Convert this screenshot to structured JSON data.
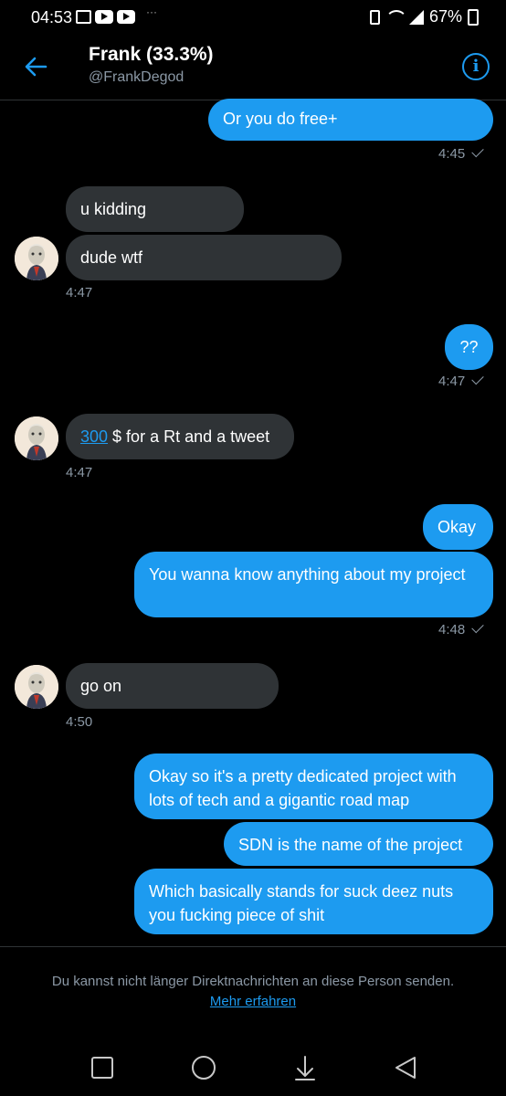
{
  "status_bar": {
    "time": "04:53",
    "dots": "···",
    "battery": "67%"
  },
  "header": {
    "name": "Frank (33.3%)",
    "handle": "@FrankDegod",
    "info_glyph": "i"
  },
  "messages": [
    {
      "id": "m1",
      "dir": "sent",
      "text": "Or you do free+"
    },
    {
      "id": "t1",
      "text": "4:45"
    },
    {
      "id": "m2",
      "dir": "recv",
      "text": "u kidding"
    },
    {
      "id": "m3",
      "dir": "recv",
      "text": "dude wtf"
    },
    {
      "id": "t2",
      "text": "4:47"
    },
    {
      "id": "m4",
      "dir": "sent",
      "text": "??"
    },
    {
      "id": "t3",
      "text": "4:47"
    },
    {
      "id": "m5",
      "dir": "recv",
      "link": "300",
      "text": " $ for a Rt and a tweet"
    },
    {
      "id": "t4",
      "text": "4:47"
    },
    {
      "id": "m6",
      "dir": "sent",
      "text": "Okay"
    },
    {
      "id": "m7",
      "dir": "sent",
      "text": "You wanna know anything about my project"
    },
    {
      "id": "t5",
      "text": "4:48"
    },
    {
      "id": "m8",
      "dir": "recv",
      "text": "go on"
    },
    {
      "id": "t6",
      "text": "4:50"
    },
    {
      "id": "m9",
      "dir": "sent",
      "text": "Okay so it's a pretty dedicated project with lots of tech and a gigantic road map"
    },
    {
      "id": "m10",
      "dir": "sent",
      "text": "SDN is the name of the project"
    },
    {
      "id": "m11",
      "dir": "sent",
      "text": "Which basically stands for suck deez nuts you fucking piece of shit"
    }
  ],
  "footer": {
    "notice": "Du kannst nicht länger Direktnachrichten an diese Person senden.",
    "link": "Mehr erfahren"
  },
  "colors": {
    "accent": "#1d9bf0",
    "received_bubble": "#2f3336",
    "muted_text": "#8b98a5",
    "background": "#000000"
  },
  "icons": [
    "back-arrow-icon",
    "info-icon",
    "read-check-icon",
    "recents-icon",
    "home-icon",
    "scroll-down-icon",
    "back-icon"
  ]
}
